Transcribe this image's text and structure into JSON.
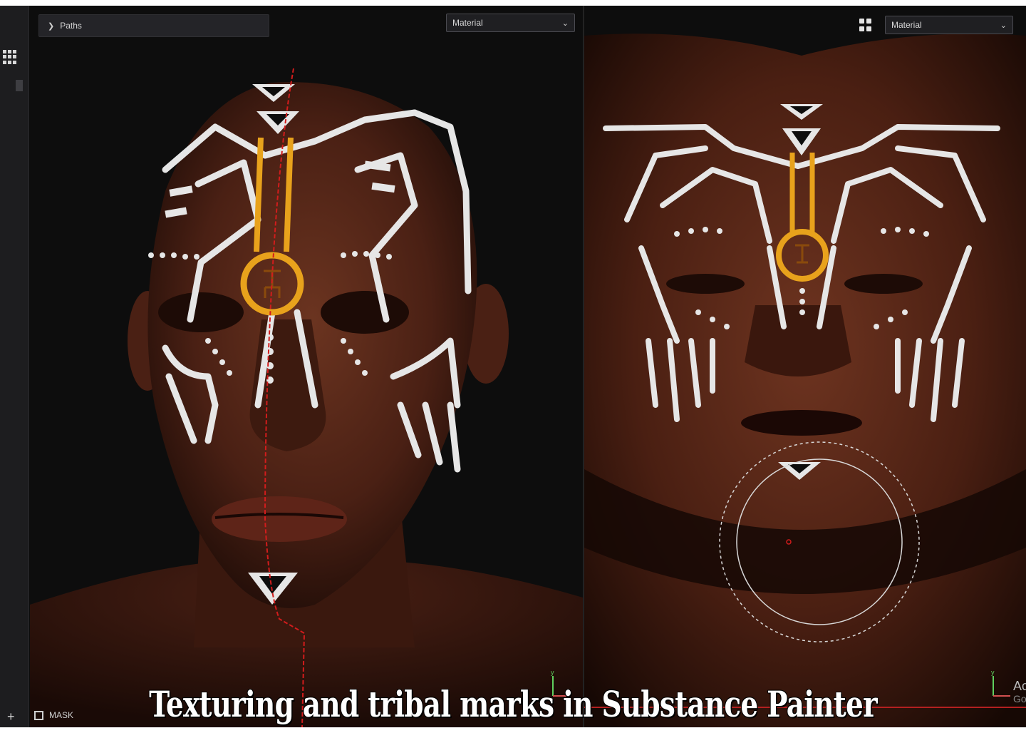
{
  "left_viewport": {
    "paths_panel": {
      "label": "Paths"
    },
    "material_select": {
      "value": "Material"
    },
    "mask_label": "MASK"
  },
  "right_viewport": {
    "material_select": {
      "value": "Material"
    },
    "edge_text": {
      "line1": "Ac",
      "line2": "Go"
    }
  },
  "caption": "Texturing and tribal marks in Substance Painter",
  "icons": [
    "chevron-right-icon",
    "chevron-down-icon",
    "grid-icon",
    "view-mode-icon",
    "plus-icon",
    "mask-icon",
    "axis-gizmo-icon",
    "brush-cursor-icon"
  ],
  "colors": {
    "skin": "#5a2a1a",
    "paint_white": "#e6e6e6",
    "paint_gold": "#e8a21c",
    "seam_red": "#d21c1c",
    "ui_panel": "#242428"
  }
}
